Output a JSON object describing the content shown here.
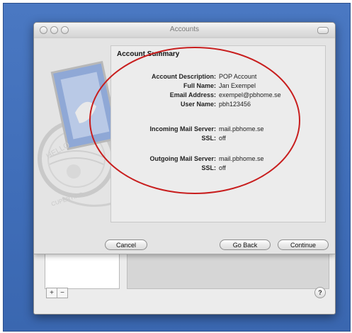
{
  "window": {
    "title": "Accounts"
  },
  "summary": {
    "heading": "Account Summary",
    "rows": [
      {
        "label": "Account Description:",
        "value": "POP Account"
      },
      {
        "label": "Full Name:",
        "value": "Jan Exempel"
      },
      {
        "label": "Email Address:",
        "value": "exempel@pbhome.se"
      },
      {
        "label": "User Name:",
        "value": "pbh123456"
      },
      {
        "label": "Incoming Mail Server:",
        "value": "mail.pbhome.se"
      },
      {
        "label": "SSL:",
        "value": "off"
      },
      {
        "label": "Outgoing Mail Server:",
        "value": "mail.pbhome.se"
      },
      {
        "label": "SSL:",
        "value": "off"
      }
    ]
  },
  "buttons": {
    "cancel": "Cancel",
    "go_back": "Go Back",
    "continue": "Continue"
  },
  "stamp": {
    "text_top": "HELLO",
    "text_bottom": "CUPERTINO"
  },
  "bottom_bar": {
    "plus": "+",
    "minus": "−",
    "help": "?"
  },
  "colors": {
    "desktop": "#3f6db8",
    "annotation_ellipse": "#c81e1e"
  }
}
